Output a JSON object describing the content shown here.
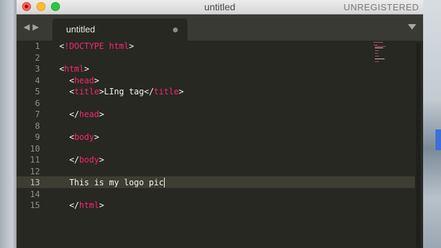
{
  "window": {
    "title": "untitled",
    "status": "UNREGISTERED"
  },
  "tabbar": {
    "back_arrow": "◀",
    "forward_arrow": "▶",
    "tab_label": "untitled",
    "dirty_indicator": "●",
    "menu_icon": "chevron-down-icon"
  },
  "editor": {
    "active_line": 13,
    "line_numbers": [
      "1",
      "2",
      "3",
      "4",
      "5",
      "6",
      "7",
      "8",
      "9",
      "10",
      "11",
      "12",
      "13",
      "14",
      "15"
    ],
    "lines": {
      "l1": {
        "lt": "<",
        "tag": "!DOCTYPE",
        "rest": " ",
        "word": "html",
        "gt": ">"
      },
      "l3": {
        "lt": "<",
        "tag": "html",
        "gt": ">"
      },
      "l4": {
        "indent": "  ",
        "lt": "<",
        "tag": "head",
        "gt": ">"
      },
      "l5": {
        "indent": "  ",
        "lt": "<",
        "tag": "title",
        "gt": ">",
        "text": "LIng tag",
        "lt2": "</",
        "tag2": "title",
        "gt2": ">"
      },
      "l7": {
        "indent": "  ",
        "lt": "</",
        "tag": "head",
        "gt": ">"
      },
      "l9": {
        "indent": "  ",
        "lt": "<",
        "tag": "body",
        "gt": ">"
      },
      "l11": {
        "indent": "  ",
        "lt": "</",
        "tag": "body",
        "gt": ">"
      },
      "l13": {
        "indent": "  ",
        "text": "This is my logo pic"
      },
      "l15": {
        "indent": "  ",
        "lt": "</",
        "tag": "html",
        "gt": ">"
      }
    }
  },
  "colors": {
    "editor_bg": "#272822",
    "tag": "#f92672",
    "text": "#f8f8f2",
    "line_number": "#90908a",
    "active_line": "#3e3d32"
  }
}
